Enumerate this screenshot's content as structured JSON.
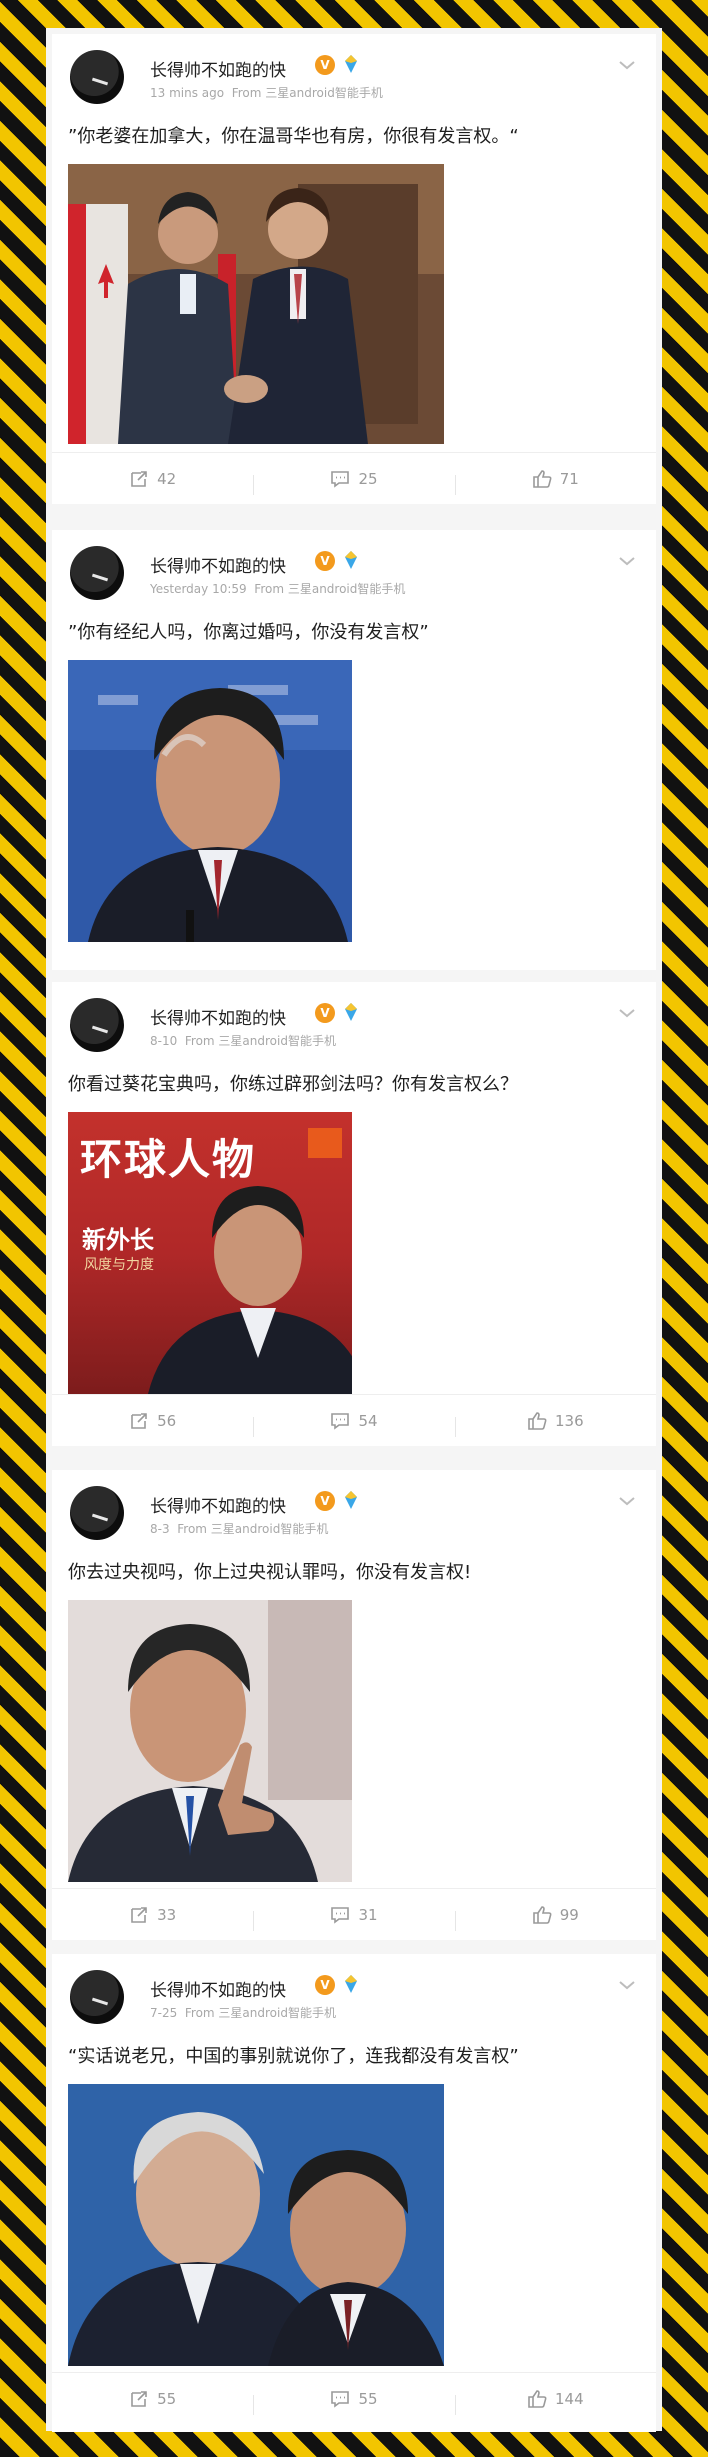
{
  "posts": [
    {
      "username": "长得帅不如跑的快",
      "badge": "V",
      "time": "13 mins ago",
      "source": "From 三星android智能手机",
      "content": "”你老婆在加拿大，你在温哥华也有房，你很有发言权。“",
      "actions": {
        "repost": "42",
        "comment": "25",
        "like": "71"
      }
    },
    {
      "username": "长得帅不如跑的快",
      "badge": "V",
      "time": "Yesterday 10:59",
      "source": "From 三星android智能手机",
      "content": "”你有经纪人吗，你离过婚吗，你没有发言权”"
    },
    {
      "username": "长得帅不如跑的快",
      "badge": "V",
      "time": "8-10",
      "source": "From 三星android智能手机",
      "content": "你看过葵花宝典吗，你练过辟邪剑法吗？你有发言权么？",
      "image_text": {
        "magazine": "环球人物",
        "headline": "新外长",
        "sub": "风度与力度"
      },
      "actions": {
        "repost": "56",
        "comment": "54",
        "like": "136"
      }
    },
    {
      "username": "长得帅不如跑的快",
      "badge": "V",
      "time": "8-3",
      "source": "From 三星android智能手机",
      "content": "你去过央视吗，你上过央视认罪吗，你没有发言权!",
      "actions": {
        "repost": "33",
        "comment": "31",
        "like": "99"
      }
    },
    {
      "username": "长得帅不如跑的快",
      "badge": "V",
      "time": "7-25",
      "source": "From 三星android智能手机",
      "content": "“实话说老兄，中国的事别就说你了，连我都没有发言权”",
      "actions": {
        "repost": "55",
        "comment": "55",
        "like": "144"
      }
    }
  ]
}
